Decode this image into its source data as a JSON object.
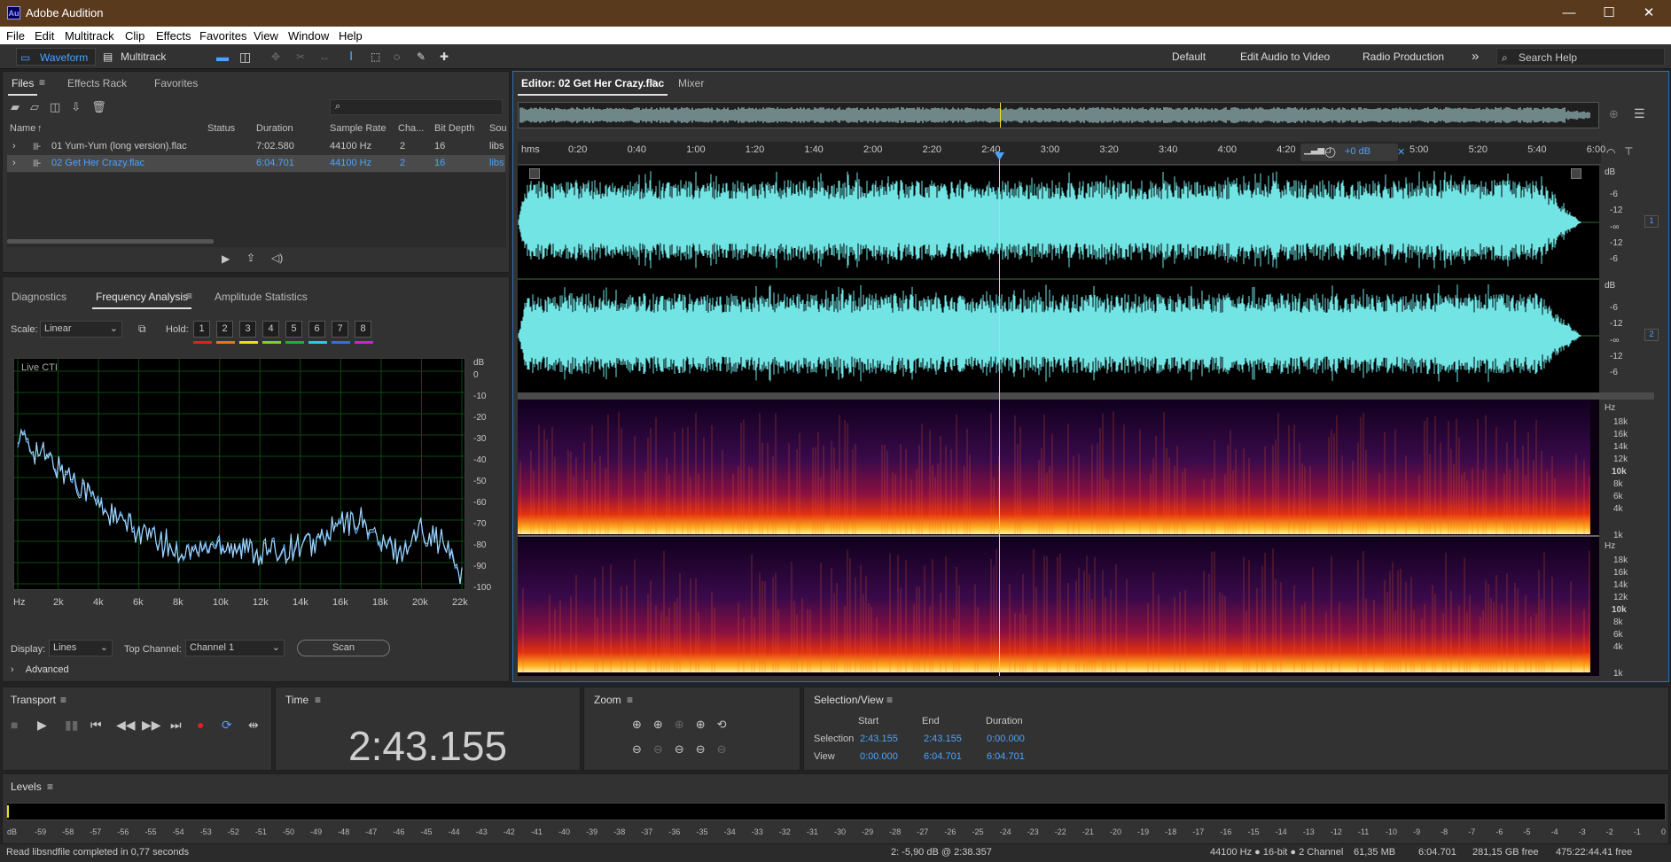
{
  "app": {
    "title": "Adobe Audition",
    "logo": "Au"
  },
  "window_controls": [
    "—",
    "☐",
    "✕"
  ],
  "menu": [
    "File",
    "Edit",
    "Multitrack",
    "Clip",
    "Effects",
    "Favorites",
    "View",
    "Window",
    "Help"
  ],
  "toolbar": {
    "waveform": "Waveform",
    "multitrack": "Multitrack",
    "workspaces": [
      "Default",
      "Edit Audio to Video",
      "Radio Production"
    ],
    "more": "»",
    "search_placeholder": "Search Help"
  },
  "files_panel": {
    "tabs": [
      "Files",
      "Effects Rack",
      "Favorites"
    ],
    "columns": [
      "Name",
      "Status",
      "Duration",
      "Sample Rate",
      "Cha...",
      "Bit Depth",
      "Sou"
    ],
    "rows": [
      {
        "name": "01 Yum-Yum (long version).flac",
        "status": "",
        "duration": "7:02.580",
        "rate": "44100 Hz",
        "channels": "2",
        "bits": "16",
        "source": "libs",
        "selected": false
      },
      {
        "name": "02 Get Her Crazy.flac",
        "status": "",
        "duration": "6:04.701",
        "rate": "44100 Hz",
        "channels": "2",
        "bits": "16",
        "source": "libs",
        "selected": true
      }
    ]
  },
  "analysis_panel": {
    "tabs": [
      "Diagnostics",
      "Frequency Analysis",
      "Amplitude Statistics"
    ],
    "scale_label": "Scale:",
    "scale_value": "Linear",
    "hold_label": "Hold:",
    "holds": [
      "1",
      "2",
      "3",
      "4",
      "5",
      "6",
      "7",
      "8"
    ],
    "hold_colors": [
      "#e01f1f",
      "#e07a10",
      "#e8e010",
      "#7fd020",
      "#20b030",
      "#20d0e0",
      "#3070e0",
      "#d020d0"
    ],
    "live_label": "Live CTI",
    "db_unit": "dB",
    "db_ticks": [
      "0",
      "-10",
      "-20",
      "-30",
      "-40",
      "-50",
      "-60",
      "-70",
      "-80",
      "-90",
      "-100"
    ],
    "hz_ticks": [
      "Hz",
      "2k",
      "4k",
      "6k",
      "8k",
      "10k",
      "12k",
      "14k",
      "16k",
      "18k",
      "20k",
      "22k"
    ],
    "display_label": "Display:",
    "display_value": "Lines",
    "top_channel_label": "Top Channel:",
    "top_channel_value": "Channel 1",
    "scan_label": "Scan",
    "advanced_label": "Advanced",
    "chart_data": {
      "type": "line",
      "x": [
        0,
        1,
        2,
        3,
        4,
        5,
        6,
        7,
        8,
        9,
        10,
        11,
        12,
        13,
        14,
        15,
        16,
        17,
        18,
        19,
        20,
        21,
        22
      ],
      "values": [
        -30,
        -38,
        -45,
        -52,
        -62,
        -70,
        -75,
        -80,
        -85,
        -84,
        -80,
        -83,
        -85,
        -84,
        -82,
        -80,
        -72,
        -70,
        -82,
        -85,
        -74,
        -80,
        -96
      ],
      "xlabel": "",
      "ylabel": "dB",
      "ylim": [
        -100,
        0
      ],
      "xlim": [
        0,
        22
      ]
    }
  },
  "editor": {
    "tab": "Editor: 02 Get Her Crazy.flac",
    "mixer": "Mixer",
    "time_unit": "hms",
    "ruler": [
      "0:20",
      "0:40",
      "1:00",
      "1:20",
      "1:40",
      "2:00",
      "2:20",
      "2:40",
      "3:00",
      "3:20",
      "3:40",
      "4:00",
      "4:20",
      "5:00",
      "5:20",
      "5:40",
      "6:00"
    ],
    "hud_gain": "+0 dB",
    "db_scale": [
      "dB",
      "-6",
      "-12",
      "-∞",
      "-12",
      "-6"
    ],
    "channels": [
      "1",
      "2"
    ],
    "hz_scale": [
      "Hz",
      "18k",
      "16k",
      "14k",
      "12k",
      "10k",
      "8k",
      "6k",
      "4k",
      "1k"
    ]
  },
  "transport": {
    "title": "Transport"
  },
  "time": {
    "title": "Time",
    "value": "2:43.155"
  },
  "zoom": {
    "title": "Zoom"
  },
  "selection_view": {
    "title": "Selection/View",
    "cols": [
      "Start",
      "End",
      "Duration"
    ],
    "rows": [
      {
        "label": "Selection",
        "start": "2:43.155",
        "end": "2:43.155",
        "duration": "0:00.000"
      },
      {
        "label": "View",
        "start": "0:00.000",
        "end": "6:04.701",
        "duration": "6:04.701"
      }
    ]
  },
  "levels": {
    "title": "Levels",
    "scale": [
      "dB",
      "-59",
      "-58",
      "-57",
      "-56",
      "-55",
      "-54",
      "-53",
      "-52",
      "-51",
      "-50",
      "-49",
      "-48",
      "-47",
      "-46",
      "-45",
      "-44",
      "-43",
      "-42",
      "-41",
      "-40",
      "-39",
      "-38",
      "-37",
      "-36",
      "-35",
      "-34",
      "-33",
      "-32",
      "-31",
      "-30",
      "-29",
      "-28",
      "-27",
      "-26",
      "-25",
      "-24",
      "-23",
      "-22",
      "-21",
      "-20",
      "-19",
      "-18",
      "-17",
      "-16",
      "-15",
      "-14",
      "-13",
      "-12",
      "-11",
      "-10",
      "-9",
      "-8",
      "-7",
      "-6",
      "-5",
      "-4",
      "-3",
      "-2",
      "-1",
      "0"
    ]
  },
  "status": {
    "left": "Read libsndfile completed in 0,77 seconds",
    "cursor": "2: -5,90 dB @ 2:38.357",
    "format": "44100 Hz ● 16-bit ● 2 Channel",
    "size": "61,35 MB",
    "duration": "6:04.701",
    "free": "281,15 GB free",
    "free_time": "475:22:44.41 free"
  }
}
